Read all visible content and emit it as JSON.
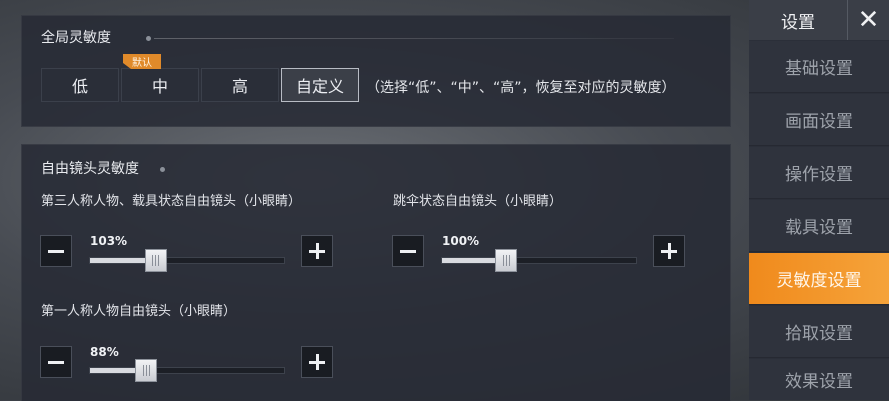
{
  "global_sensitivity": {
    "title": "全局灵敏度",
    "badge": "默认",
    "options": [
      "低",
      "中",
      "高",
      "自定义"
    ],
    "selected": "自定义",
    "hint": "（选择“低”、“中”、“高”，恢复至对应的灵敏度）"
  },
  "free_look": {
    "title": "自由镜头灵敏度",
    "sliders": [
      {
        "label": "第三人称人物、载具状态自由镜头（小眼睛）",
        "value_text": "103%",
        "fraction": 0.34
      },
      {
        "label": "跳伞状态自由镜头（小眼睛）",
        "value_text": "100%",
        "fraction": 0.33
      },
      {
        "label": "第一人称人物自由镜头（小眼睛）",
        "value_text": "88%",
        "fraction": 0.29
      }
    ]
  },
  "sidebar": {
    "title": "设置",
    "close_icon": "close-icon",
    "items": [
      "基础设置",
      "画面设置",
      "操作设置",
      "载具设置",
      "灵敏度设置",
      "拾取设置",
      "效果设置"
    ],
    "active": "灵敏度设置"
  },
  "colors": {
    "accent": "#f08a1c",
    "badge": "#e08a2a"
  }
}
